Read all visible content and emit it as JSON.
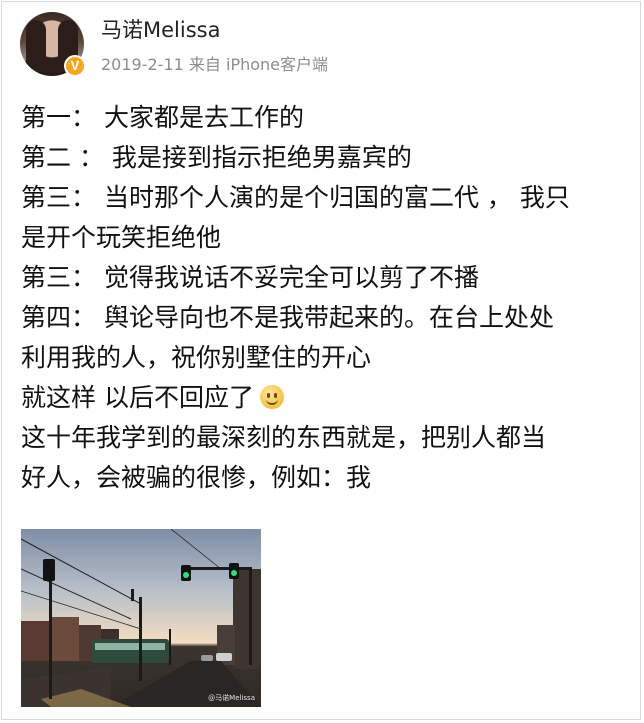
{
  "author": {
    "name": "马诺Melissa",
    "verified_badge": "V",
    "post_date": "2019-2-11",
    "source": "来自 iPhone客户端"
  },
  "post": {
    "lines": [
      "第一：  大家都是去工作的",
      "第二 ：  我是接到指示拒绝男嘉宾的",
      "第三：  当时那个人演的是个归国的富二代 ， 我只",
      "是开个玩笑拒绝他",
      "第三：  觉得我说话不妥完全可以剪了不播",
      "第四：  舆论导向也不是我带起来的。在台上处处",
      "利用我的人，祝你别墅住的开心",
      "就这样 以后不回应了",
      "这十年我学到的最深刻的东西就是，把别人都当",
      "好人，会被骗的很惨，例如：我"
    ],
    "emoji": "smiley-face"
  },
  "image": {
    "watermark": "@马诺Melissa"
  },
  "colors": {
    "badge": "#f5a623",
    "meta_text": "#8d8d8d",
    "body_text": "#111111"
  }
}
